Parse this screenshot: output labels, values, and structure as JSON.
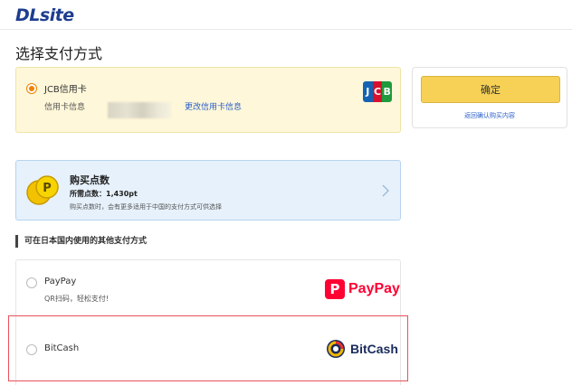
{
  "header": {
    "logo_text": "DLsite"
  },
  "page_title": "选择支付方式",
  "selected_method": {
    "name": "JCB信用卡",
    "info_label": "信用卡信息",
    "change_link": "更改信用卡信息"
  },
  "confirm": {
    "button_label": "确定",
    "back_link": "返回确认购买内容"
  },
  "points": {
    "title": "购买点数",
    "required": "所需点数：1,430pt",
    "note": "购买点数时，会有更多适用于中国的支付方式可供选择"
  },
  "other_methods": {
    "heading": "可在日本国内使用的其他支付方式",
    "items": [
      {
        "name": "PayPay",
        "desc": "QR扫码，轻松支付!",
        "logo_text": "PayPay",
        "logo_mark": "P"
      },
      {
        "name": "BitCash",
        "logo_text": "BitCash"
      }
    ]
  },
  "jcb_logo": [
    "J",
    "C",
    "B"
  ],
  "colors": {
    "accent_orange": "#f08200",
    "link_blue": "#2a5fc9",
    "confirm_yellow": "#f7d155",
    "paypay_red": "#ff0033",
    "highlight_red": "#e8505b"
  }
}
